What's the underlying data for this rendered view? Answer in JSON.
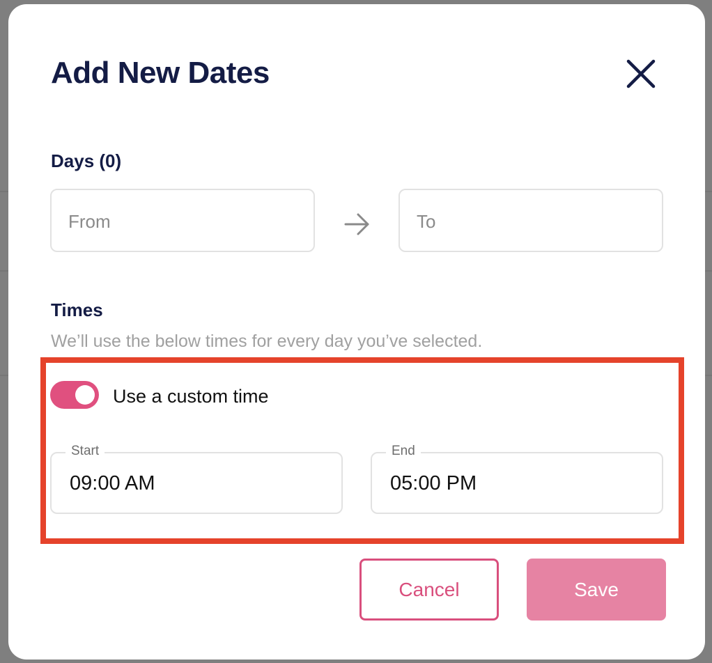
{
  "dialog": {
    "title": "Add New Dates",
    "close_icon": "close-icon"
  },
  "days": {
    "label": "Days (0)",
    "from_placeholder": "From",
    "from_value": "",
    "to_placeholder": "To",
    "to_value": "",
    "separator_icon": "arrow-right-icon"
  },
  "times": {
    "label": "Times",
    "description": "We’ll use the below times for every day you’ve selected.",
    "custom_time_toggle": {
      "label": "Use a custom time",
      "checked": true
    },
    "start": {
      "label": "Start",
      "value": "09:00 AM"
    },
    "end": {
      "label": "End",
      "value": "05:00 PM"
    }
  },
  "actions": {
    "cancel_label": "Cancel",
    "save_label": "Save"
  },
  "colors": {
    "title_text": "#141c45",
    "accent_pink": "#e0507f",
    "save_button_bg": "#e683a3",
    "cancel_border": "#d94f7d",
    "highlight_border": "#e5432b",
    "backdrop": "#7f7f7f"
  }
}
